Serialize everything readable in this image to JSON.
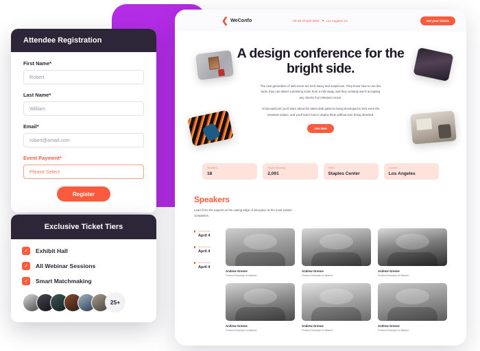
{
  "colors": {
    "purple_accent": "#b32ce6",
    "orange_accent": "#fb5b3d",
    "dark_header": "#2d2638",
    "stat_chip_bg": "#fde3dc"
  },
  "registration": {
    "title": "Attendee Registration",
    "fields": [
      {
        "label": "First Name*",
        "value": "Robert",
        "required": false
      },
      {
        "label": "Last Name*",
        "value": "William",
        "required": false
      },
      {
        "label": "Email*",
        "value": "robert@email.com",
        "required": false
      },
      {
        "label": "Event Payment*",
        "value": "Please Select",
        "required": true
      }
    ],
    "submit_label": "Register"
  },
  "tiers": {
    "title": "Exclusive Ticket Tiers",
    "check_glyph": "✓",
    "items": [
      {
        "label": "Exhibit Hall"
      },
      {
        "label": "All Webinar Sessions"
      },
      {
        "label": "Smart Matchmaking"
      }
    ],
    "avatar_count_label": "25+"
  },
  "site": {
    "nav": {
      "brand_mark": "❮",
      "brand_name": "WeConfo",
      "date_text": "04-06 of April 2022",
      "location_text": "Los Angeles CA",
      "cta_label": "Get your tickets"
    },
    "hero": {
      "title": "A design conference for the bright side.",
      "paragraph_1": "The next generation of web users are tech-savvy and suspicious. They know how to use dev tools, they can detect a phishing scam from a mile away, and they certainly aren't accepting any checks from Western Union.",
      "paragraph_2": "At DeceptiConf you'll learn about the latest dark patterns being developed to trick even the smartest visitors, and you'll learn how to deploy them without ever being detected.",
      "join_label": "Join Now"
    },
    "stats": [
      {
        "label": "Speakers",
        "value": "18"
      },
      {
        "label": "People Attending",
        "value": "2,091"
      },
      {
        "label": "Venue",
        "value": "Staples Center"
      },
      {
        "label": "Location",
        "value": "Los Angeles"
      }
    ],
    "speakers": {
      "heading": "Speakers",
      "subtitle": "Learn from the experts on the cutting-edge of deception at the most sinister companies.",
      "agenda": [
        {
          "label": "Opening Day",
          "date": "April 4"
        },
        {
          "label": "Opening Day",
          "date": "April 4"
        },
        {
          "label": "Opening Day",
          "date": "April 4"
        }
      ],
      "cards": [
        {
          "name": "Andrew Greene",
          "role": "Frontend Developer at Ultratech"
        },
        {
          "name": "Andrew Greene",
          "role": "Frontend Developer at Ultratech"
        },
        {
          "name": "Andrew Greene",
          "role": "Frontend Developer at Ultratech"
        },
        {
          "name": "Andrew Greene",
          "role": "Frontend Developer at Ultratech"
        },
        {
          "name": "Andrew Greene",
          "role": "Frontend Developer at Ultratech"
        },
        {
          "name": "Andrew Greene",
          "role": "Frontend Developer at Ultratech"
        }
      ]
    }
  }
}
